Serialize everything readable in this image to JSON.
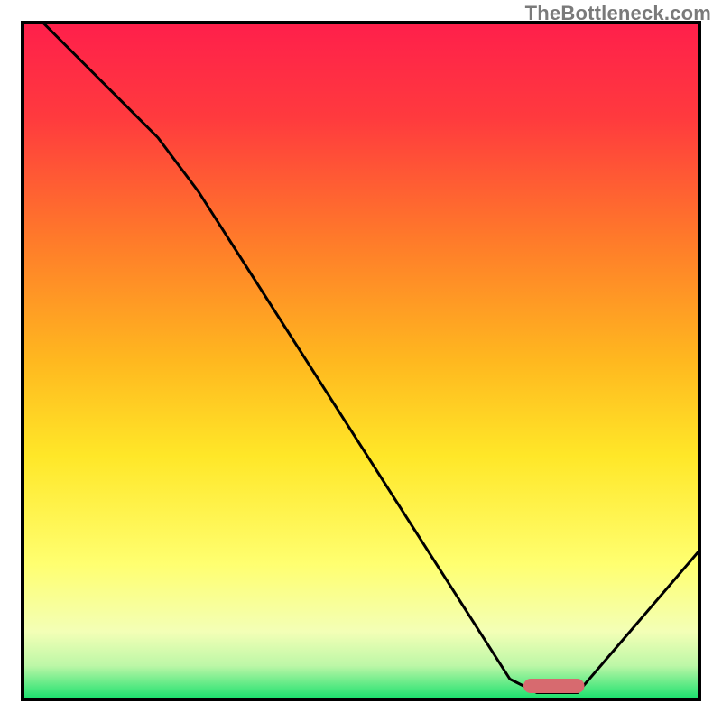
{
  "watermark": "TheBottleneck.com",
  "chart_data": {
    "type": "line",
    "title": "",
    "xlabel": "",
    "ylabel": "",
    "xlim": [
      0,
      100
    ],
    "ylim": [
      0,
      100
    ],
    "grid": false,
    "legend": false,
    "background_gradient": {
      "top_color": "#ff1f4b",
      "mid_colors": [
        "#ff6a2e",
        "#ffb81f",
        "#ffe728",
        "#ffff70",
        "#d9ffb0"
      ],
      "bottom_color": "#16e06c"
    },
    "series": [
      {
        "name": "bottleneck-curve",
        "color": "#000000",
        "points": [
          {
            "x": 3,
            "y": 100
          },
          {
            "x": 20,
            "y": 83
          },
          {
            "x": 26,
            "y": 75
          },
          {
            "x": 72,
            "y": 3
          },
          {
            "x": 76,
            "y": 1
          },
          {
            "x": 82,
            "y": 1
          },
          {
            "x": 100,
            "y": 22
          }
        ]
      }
    ],
    "marker": {
      "name": "optimal-range-marker",
      "x_start": 74,
      "x_end": 83,
      "y": 2,
      "color": "#d76a6f"
    }
  }
}
